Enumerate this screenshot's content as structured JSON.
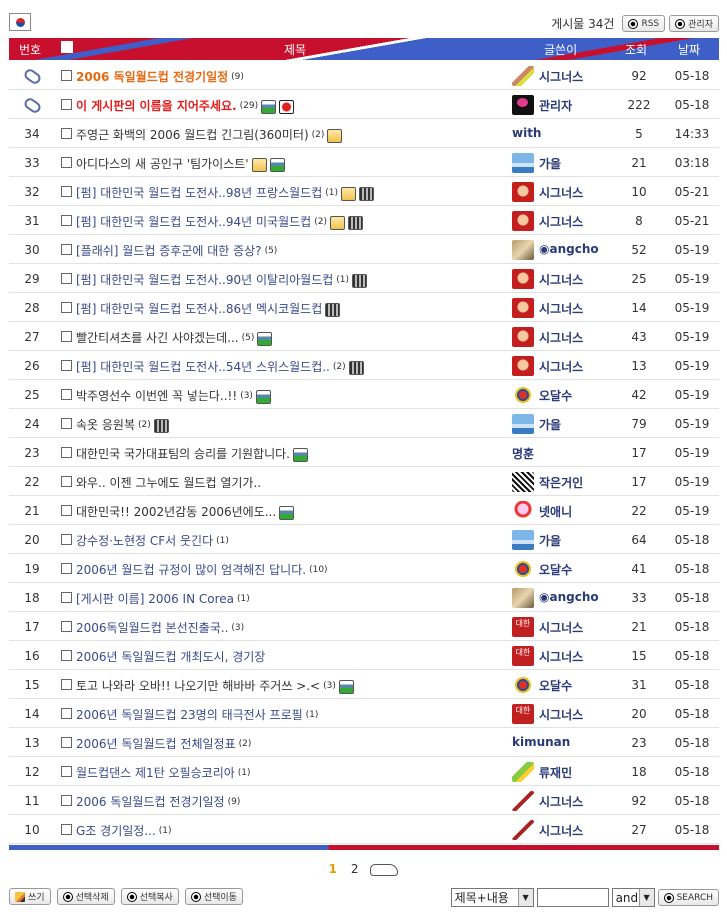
{
  "header": {
    "count_label": "게시물 34건",
    "rss_label": "RSS",
    "admin_label": "관리자"
  },
  "columns": {
    "no": "번호",
    "subject": "제목",
    "author": "글쓴이",
    "views": "조회",
    "date": "날짜"
  },
  "rows": [
    {
      "no": "",
      "notice": true,
      "subject": "2006 독일월드컵 전경기일정",
      "style": "notice-orange",
      "comments": "(9)",
      "icons": [],
      "avatar": "av-pen",
      "author": "시그너스",
      "views": "92",
      "date": "05-18"
    },
    {
      "no": "",
      "notice": true,
      "subject": "이 게시판의 이름을 지어주세요.",
      "style": "notice-red",
      "comments": "(29)",
      "icons": [
        "img",
        "bug"
      ],
      "avatar": "av-black",
      "author": "관리자",
      "views": "222",
      "date": "05-18"
    },
    {
      "no": "34",
      "subject": "주영근 화백의 2006 월드컵 긴그림(360미터)",
      "style": "",
      "comments": "(2)",
      "icons": [
        "file"
      ],
      "avatar": "",
      "author": "with",
      "views": "5",
      "date": "14:33"
    },
    {
      "no": "33",
      "subject": "아디다스의 새 공인구 '팀가이스트'",
      "style": "",
      "comments": "",
      "icons": [
        "file",
        "img"
      ],
      "avatar": "av-sky",
      "author": "가을",
      "views": "21",
      "date": "03:18"
    },
    {
      "no": "32",
      "subject": "[펌] 대한민국 월드컵 도전사..98년 프랑스월드컵",
      "style": "link",
      "comments": "(1)",
      "icons": [
        "file",
        "mov"
      ],
      "avatar": "av-red",
      "author": "시그너스",
      "views": "10",
      "date": "05-21"
    },
    {
      "no": "31",
      "subject": "[펌] 대한민국 월드컵 도전사..94년 미국월드컵",
      "style": "link",
      "comments": "(2)",
      "icons": [
        "file",
        "mov"
      ],
      "avatar": "av-red",
      "author": "시그너스",
      "views": "8",
      "date": "05-21"
    },
    {
      "no": "30",
      "subject": "[플래쉬] 월드컵 증후군에 대한 증상?",
      "style": "link",
      "comments": "(5)",
      "icons": [],
      "avatar": "av-cat",
      "author": "◉angcho",
      "views": "52",
      "date": "05-19"
    },
    {
      "no": "29",
      "subject": "[펌] 대한민국 월드컵 도전사..90년 이탈리아월드컵",
      "style": "link",
      "comments": "(1)",
      "icons": [
        "mov"
      ],
      "avatar": "av-red",
      "author": "시그너스",
      "views": "25",
      "date": "05-19"
    },
    {
      "no": "28",
      "subject": "[펌] 대한민국 월드컵 도전사..86년 멕시코월드컵",
      "style": "link",
      "comments": "",
      "icons": [
        "mov"
      ],
      "avatar": "av-red",
      "author": "시그너스",
      "views": "14",
      "date": "05-19"
    },
    {
      "no": "27",
      "subject": "빨간티셔츠를 사긴 사야겠는데...",
      "style": "",
      "comments": "(5)",
      "icons": [
        "img"
      ],
      "avatar": "av-red",
      "author": "시그너스",
      "views": "43",
      "date": "05-19"
    },
    {
      "no": "26",
      "subject": "[펌] 대한민국 월드컵 도전사..54년 스위스월드컵..",
      "style": "link",
      "comments": "(2)",
      "icons": [
        "mov"
      ],
      "avatar": "av-red",
      "author": "시그너스",
      "views": "13",
      "date": "05-19"
    },
    {
      "no": "25",
      "subject": "박주영선수 이번엔 꼭 넣는다..!!",
      "style": "",
      "comments": "(3)",
      "icons": [
        "img"
      ],
      "avatar": "av-ball",
      "author": "오달수",
      "views": "42",
      "date": "05-19"
    },
    {
      "no": "24",
      "subject": "속옷 응원복",
      "style": "",
      "comments": "(2)",
      "icons": [
        "mov"
      ],
      "avatar": "av-sky",
      "author": "가을",
      "views": "79",
      "date": "05-19"
    },
    {
      "no": "23",
      "subject": "대한민국 국가대표팀의 승리를 기원합니다.",
      "style": "",
      "comments": "",
      "icons": [
        "img"
      ],
      "avatar": "",
      "author": "명훈",
      "views": "17",
      "date": "05-19"
    },
    {
      "no": "22",
      "subject": "와우.. 이젠 그누에도 월드컵 열기가..",
      "style": "",
      "comments": "",
      "icons": [],
      "avatar": "av-zebra",
      "author": "작은거인",
      "views": "17",
      "date": "05-19"
    },
    {
      "no": "21",
      "subject": "대한민국!! 2002년감동 2006년에도...",
      "style": "",
      "comments": "",
      "icons": [
        "img"
      ],
      "avatar": "av-doll",
      "author": "넷애니",
      "views": "22",
      "date": "05-19"
    },
    {
      "no": "20",
      "subject": "강수정·노현정 CF서 웃긴다",
      "style": "link",
      "comments": "(1)",
      "icons": [],
      "avatar": "av-sky",
      "author": "가을",
      "views": "64",
      "date": "05-18"
    },
    {
      "no": "19",
      "subject": "2006년 월드컵 규정이 많이 엄격해진 답니다.",
      "style": "link",
      "comments": "(10)",
      "icons": [],
      "avatar": "av-ball",
      "author": "오달수",
      "views": "41",
      "date": "05-18"
    },
    {
      "no": "18",
      "subject": "[게시판 이름] 2006 IN Corea",
      "style": "link",
      "comments": "(1)",
      "icons": [],
      "avatar": "av-cat",
      "author": "◉angcho",
      "views": "33",
      "date": "05-18"
    },
    {
      "no": "17",
      "subject": "2006독일월드컵 본선진출국..",
      "style": "link",
      "comments": "(3)",
      "icons": [],
      "avatar": "av-seal",
      "author": "시그너스",
      "views": "21",
      "date": "05-18"
    },
    {
      "no": "16",
      "subject": "2006년 독일월드컵 개최도시, 경기장",
      "style": "link",
      "comments": "",
      "icons": [],
      "avatar": "av-seal",
      "author": "시그너스",
      "views": "15",
      "date": "05-18"
    },
    {
      "no": "15",
      "subject": "토고 나와라 오바!! 나오기만 해바바 주거쓰 >.<",
      "style": "",
      "comments": "(3)",
      "icons": [
        "img"
      ],
      "avatar": "av-ball",
      "author": "오달수",
      "views": "31",
      "date": "05-18"
    },
    {
      "no": "14",
      "subject": "2006년 독일월드컵 23명의 태극전사 프로필",
      "style": "link",
      "comments": "(1)",
      "icons": [],
      "avatar": "av-seal",
      "author": "시그너스",
      "views": "20",
      "date": "05-18"
    },
    {
      "no": "13",
      "subject": "2006년 독일월드컵 전체일정표",
      "style": "link",
      "comments": "(2)",
      "icons": [],
      "avatar": "",
      "author": "kimunan",
      "views": "23",
      "date": "05-18"
    },
    {
      "no": "12",
      "subject": "월드컵댄스 제1탄 오필승코리아",
      "style": "link",
      "comments": "(1)",
      "icons": [],
      "avatar": "av-lime",
      "author": "류재민",
      "views": "18",
      "date": "05-18"
    },
    {
      "no": "11",
      "subject": "2006 독일월드컵 전경기일정",
      "style": "link",
      "comments": "(9)",
      "icons": [],
      "avatar": "av-brush",
      "author": "시그너스",
      "views": "92",
      "date": "05-18"
    },
    {
      "no": "10",
      "subject": "G조 경기일정...",
      "style": "link",
      "comments": "(1)",
      "icons": [],
      "avatar": "av-brush",
      "author": "시그너스",
      "views": "27",
      "date": "05-18"
    }
  ],
  "pagination": {
    "current": "1",
    "next": "2"
  },
  "actions": {
    "write": "쓰기",
    "delete_selected": "선택삭제",
    "copy_selected": "선택복사",
    "move_selected": "선택이동"
  },
  "search": {
    "field": "제목+내용",
    "operator": "and",
    "button": "SEARCH"
  },
  "colors": {
    "header_red": "#c8102e",
    "header_blue": "#3e5fc8",
    "notice_orange": "#e86a10",
    "notice_red": "#e41c1c",
    "author_blue": "#2a3a78"
  }
}
